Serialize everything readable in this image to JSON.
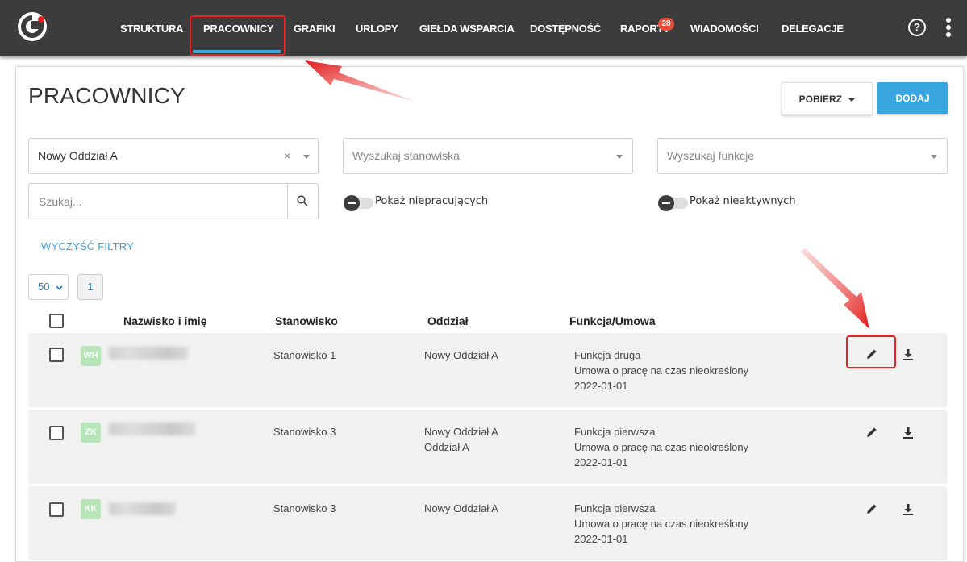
{
  "nav": {
    "items": [
      "STRUKTURA",
      "PRACOWNICY",
      "GRAFIKI",
      "URLOPY",
      "GIEŁDA WSPARCIA",
      "DOSTĘPNOŚĆ",
      "RAPORTY",
      "WIADOMOŚCI",
      "DELEGACJE"
    ],
    "active": "PRACOWNICY",
    "reports_badge": "28",
    "help_label": "?"
  },
  "page": {
    "title": "PRACOWNICY",
    "download_label": "POBIERZ",
    "add_label": "DODAJ"
  },
  "filters": {
    "branch_value": "Nowy Oddział A",
    "position_placeholder": "Wyszukaj stanowiska",
    "function_placeholder": "Wyszukaj funkcje",
    "search_placeholder": "Szukaj...",
    "show_not_working_label": "Pokaż niepracujących",
    "show_inactive_label": "Pokaż nieaktywnych",
    "clear_label": "WYCZYŚĆ FILTRY",
    "per_page": "50",
    "page": "1"
  },
  "table": {
    "headers": [
      "Nazwisko i imię",
      "Stanowisko",
      "Oddział",
      "Funkcja/Umowa"
    ],
    "rows": [
      {
        "initials": "WH",
        "position": "Stanowisko 1",
        "branch_1": "Nowy Oddział A",
        "branch_2": "",
        "function": "Funkcja druga",
        "contract": "Umowa o pracę na czas nieokreślony",
        "date": "2022-01-01"
      },
      {
        "initials": "ZK",
        "position": "Stanowisko 3",
        "branch_1": "Nowy Oddział A",
        "branch_2": "Oddział A",
        "function": "Funkcja pierwsza",
        "contract": "Umowa o pracę na czas nieokreślony",
        "date": "2022-01-01"
      },
      {
        "initials": "KK",
        "position": "Stanowisko 3",
        "branch_1": "Nowy Oddział A",
        "branch_2": "",
        "function": "Funkcja pierwsza",
        "contract": "Umowa o pracę na czas nieokreślony",
        "date": "2022-01-01"
      }
    ]
  },
  "colors": {
    "topbar": "#3c3c3c",
    "accent": "#3aa6e0",
    "annotation": "#e52224",
    "row_bg": "#f1f1f1",
    "avatar": "#b7e5b7"
  },
  "icons": [
    "logo-icon",
    "help-icon",
    "kebab-menu-icon",
    "search-icon",
    "edit-icon",
    "download-icon",
    "chevron-down-icon"
  ]
}
